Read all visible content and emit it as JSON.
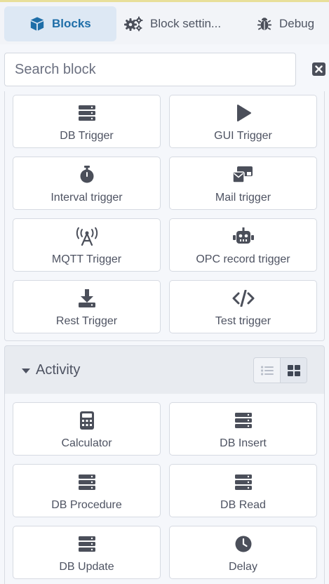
{
  "tabs": [
    {
      "label": "Blocks",
      "icon": "cube-icon",
      "active": true
    },
    {
      "label": "Block settin...",
      "icon": "gears-icon",
      "active": false
    },
    {
      "label": "Debug",
      "icon": "bug-icon",
      "active": false
    }
  ],
  "search": {
    "placeholder": "Search block",
    "value": ""
  },
  "triggers": [
    {
      "label": "DB Trigger",
      "icon": "database-icon"
    },
    {
      "label": "GUI Trigger",
      "icon": "play-icon"
    },
    {
      "label": "Interval trigger",
      "icon": "stopwatch-icon"
    },
    {
      "label": "Mail trigger",
      "icon": "mail-bulk-icon"
    },
    {
      "label": "MQTT Trigger",
      "icon": "broadcast-tower-icon"
    },
    {
      "label": "OPC record trigger",
      "icon": "robot-icon"
    },
    {
      "label": "Rest Trigger",
      "icon": "download-icon"
    },
    {
      "label": "Test trigger",
      "icon": "code-icon"
    }
  ],
  "activity": {
    "title": "Activity",
    "view_mode": "grid",
    "blocks": [
      {
        "label": "Calculator",
        "icon": "calculator-icon"
      },
      {
        "label": "DB Insert",
        "icon": "database-icon"
      },
      {
        "label": "DB Procedure",
        "icon": "database-icon"
      },
      {
        "label": "DB Read",
        "icon": "database-icon"
      },
      {
        "label": "DB Update",
        "icon": "database-icon"
      },
      {
        "label": "Delay",
        "icon": "clock-icon"
      }
    ]
  },
  "colors": {
    "accent": "#1e6ea8",
    "icon": "#4b4f5a",
    "tab_active_bg": "#dde8f4"
  }
}
